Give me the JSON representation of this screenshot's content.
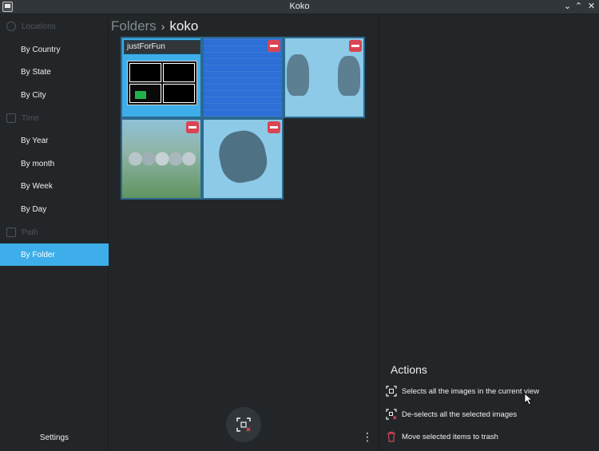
{
  "window": {
    "title": "Koko"
  },
  "sidebar": {
    "sections": [
      {
        "label": "Locations",
        "icon": "globe-icon"
      },
      {
        "label": "Time",
        "icon": "calendar-icon"
      },
      {
        "label": "Path",
        "icon": "folder-icon"
      }
    ],
    "items": [
      {
        "label": "By Country"
      },
      {
        "label": "By State"
      },
      {
        "label": "By City"
      },
      {
        "label": "By Year"
      },
      {
        "label": "By month"
      },
      {
        "label": "By Week"
      },
      {
        "label": "By Day"
      },
      {
        "label": "By Folder",
        "active": true
      }
    ],
    "settings_label": "Settings"
  },
  "breadcrumb": {
    "parent": "Folders",
    "separator": "›",
    "current": "koko"
  },
  "tiles": [
    {
      "kind": "folder",
      "label": "justForFun"
    },
    {
      "kind": "image",
      "description_icon": "document-scan"
    },
    {
      "kind": "image",
      "description_icon": "dog-photo"
    },
    {
      "kind": "image",
      "description_icon": "puppies-photo"
    },
    {
      "kind": "image",
      "description_icon": "dog-photo"
    }
  ],
  "actions": {
    "title": "Actions",
    "items": [
      {
        "label": "Selects all the images in the current view",
        "icon": "select-all-icon"
      },
      {
        "label": "De-selects all the selected images",
        "icon": "deselect-all-icon"
      },
      {
        "label": "Move selected items to trash",
        "icon": "trash-icon"
      }
    ]
  },
  "colors": {
    "accent": "#3daee9",
    "remove": "#da4453",
    "background": "#232629"
  }
}
